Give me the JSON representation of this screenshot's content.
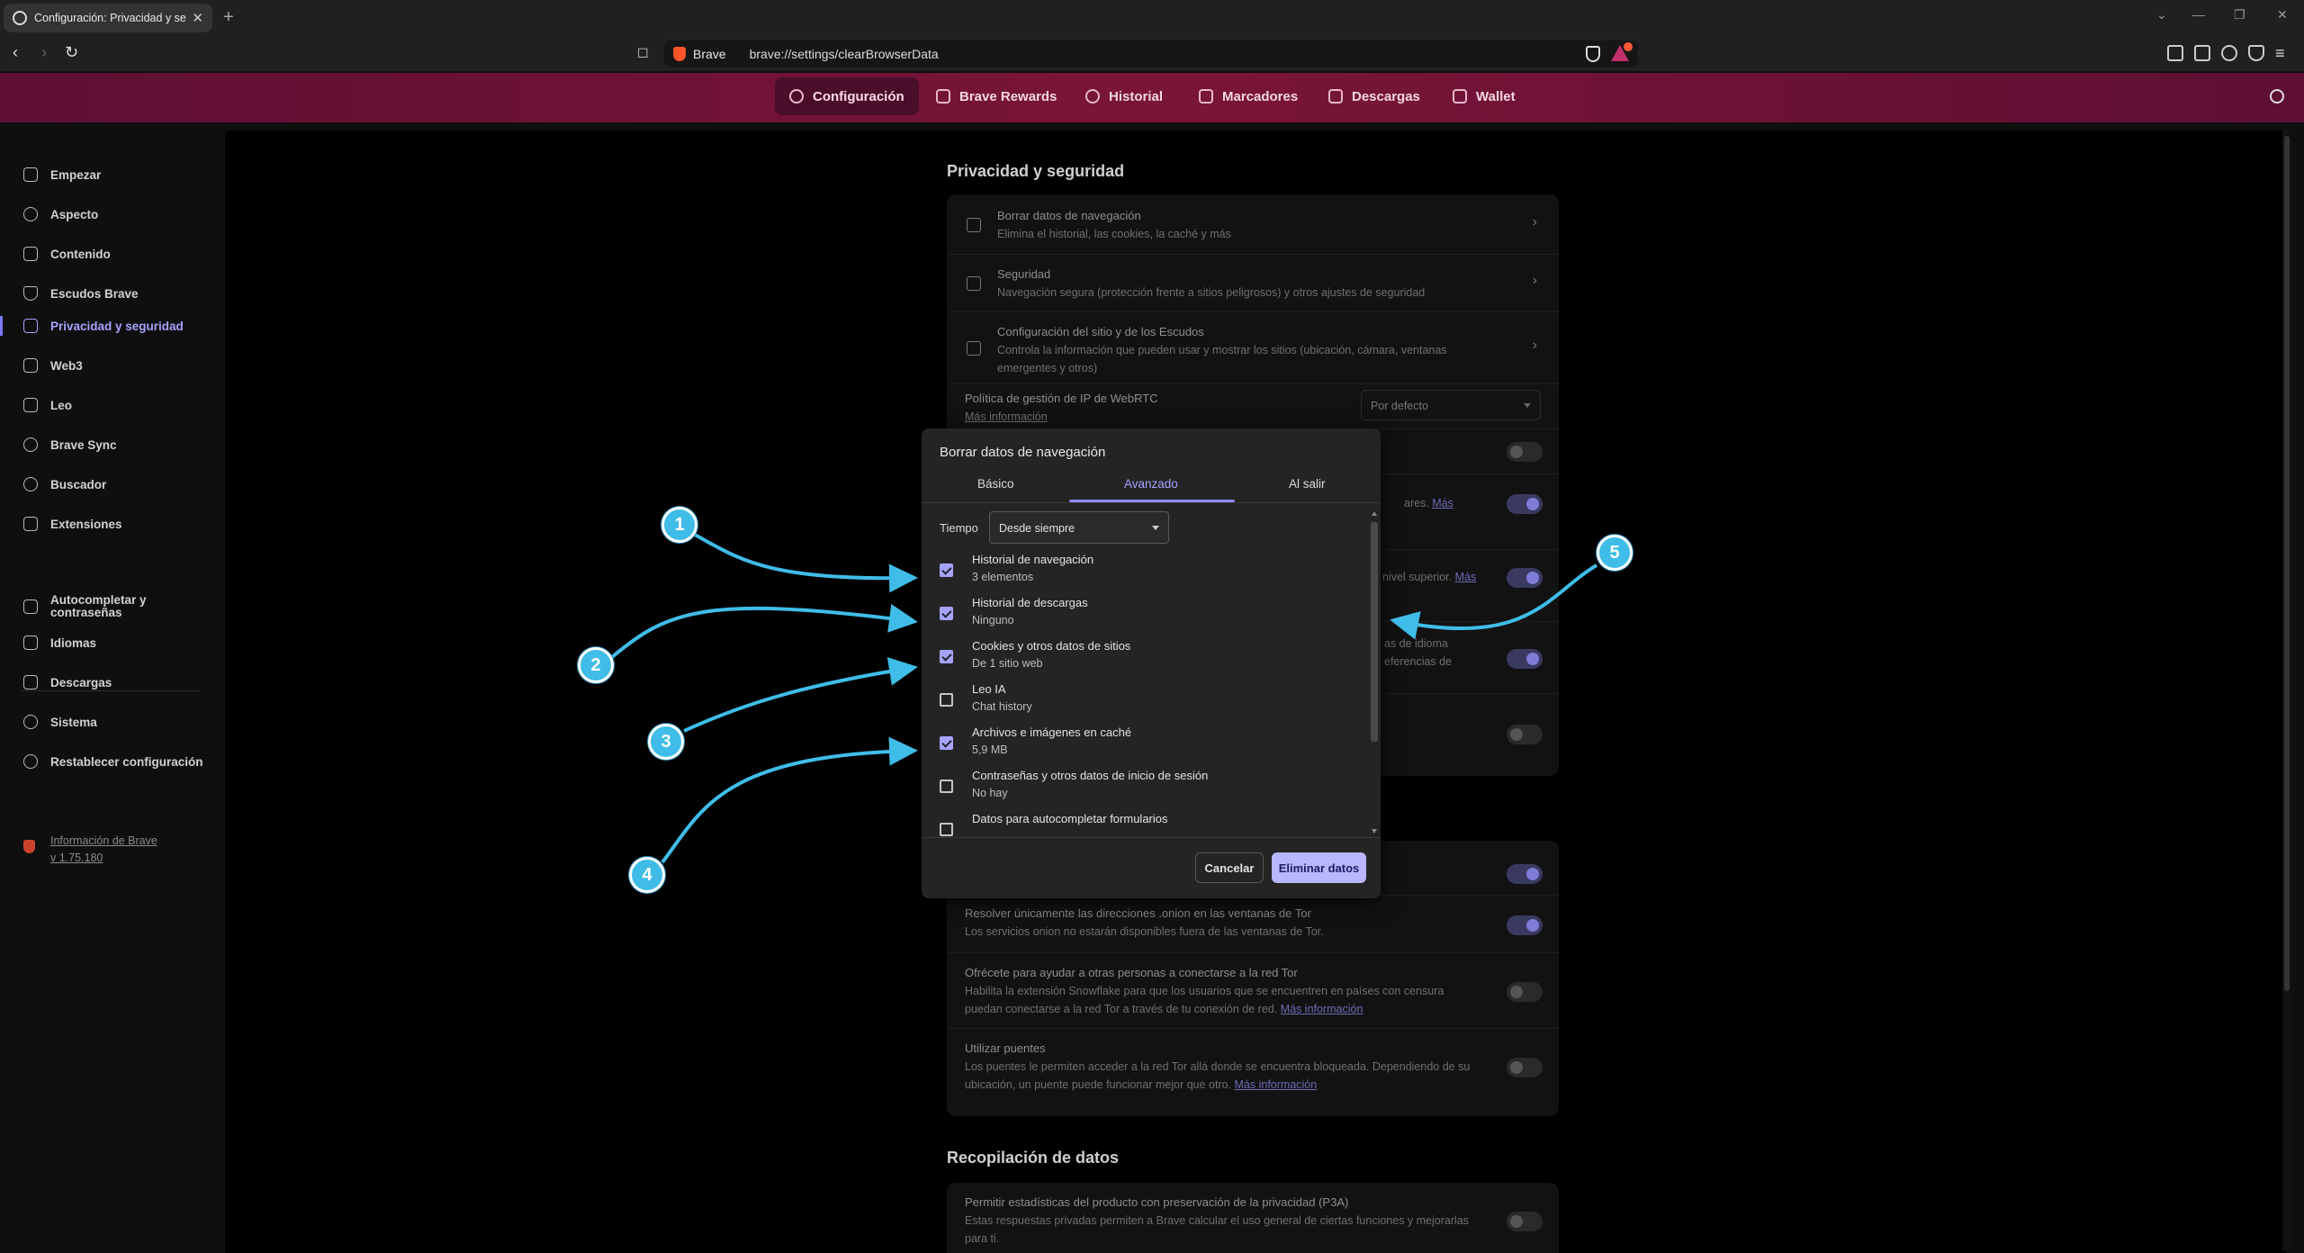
{
  "tab": {
    "title": "Configuración: Privacidad y seg",
    "close": "✕"
  },
  "newtab": "+",
  "window_controls": {
    "dropdown": "⌄",
    "minimize": "—",
    "restore": "❐",
    "close": "✕"
  },
  "toolbar": {
    "back": "‹",
    "forward": "›",
    "reload": "↻",
    "bookmark": "☐",
    "site_name": "Brave",
    "url": "brave://settings/clearBrowserData",
    "menu": "≡"
  },
  "nav": {
    "items": [
      "Configuración",
      "Brave Rewards",
      "Historial",
      "Marcadores",
      "Descargas",
      "Wallet"
    ],
    "active": 0
  },
  "sidebar": {
    "items": [
      "Empezar",
      "Aspecto",
      "Contenido",
      "Escudos Brave",
      "Privacidad y seguridad",
      "Web3",
      "Leo",
      "Brave Sync",
      "Buscador",
      "Extensiones",
      "Autocompletar y contraseñas",
      "Idiomas",
      "Descargas",
      "Sistema",
      "Restablecer configuración"
    ],
    "active": 4,
    "about_line1": "Información de Brave",
    "about_line2": "v 1.75.180"
  },
  "privacy": {
    "title": "Privacidad y seguridad",
    "rows": [
      {
        "title": "Borrar datos de navegación",
        "desc": "Elimina el historial, las cookies, la caché y más"
      },
      {
        "title": "Seguridad",
        "desc": "Navegación segura (protección frente a sitios peligrosos) y otros ajustes de seguridad"
      },
      {
        "title": "Configuración del sitio y de los Escudos",
        "desc1": "Controla la información que pueden usar y mostrar los sitios (ubicación, cámara, ventanas",
        "desc2": "emergentes y otros)"
      }
    ],
    "webrtc": {
      "title": "Política de gestión de IP de WebRTC",
      "link": "Más información",
      "value": "Por defecto"
    },
    "partial": {
      "a": "ares. ",
      "a_link": "Más",
      "b": "nivel superior. ",
      "b_link": "Más",
      "c1": "as de idioma",
      "c2": "eferencias de"
    }
  },
  "tor": {
    "row1": {
      "title": "Resolver únicamente las direcciones .onion en las ventanas de Tor",
      "desc": "Los servicios onion no estarán disponibles fuera de las ventanas de Tor."
    },
    "row2": {
      "title": "Ofrécete para ayudar a otras personas a conectarse a la red Tor",
      "desc1": "Habilita la extensión Snowflake para que los usuarios que se encuentren en países con censura",
      "desc2": "puedan conectarse a la red Tor a través de tu conexión de red. ",
      "link": "Más información"
    },
    "row3": {
      "title": "Utilizar puentes",
      "desc1": "Los puentes le permiten acceder a la red Tor allá donde se encuentra bloqueada. Dependiendo de su",
      "desc2": "ubicación, un puente puede funcionar mejor que otro. ",
      "link": "Más información"
    }
  },
  "data_collection": {
    "title": "Recopilación de datos",
    "row": {
      "title": "Permitir estadísticas del producto con preservación de la privacidad (P3A)",
      "desc1": "Estas respuestas privadas permiten a Brave calcular el uso general de ciertas funciones y mejorarlas",
      "desc2": "para ti."
    }
  },
  "dialog": {
    "title": "Borrar datos de navegación",
    "tabs": [
      "Básico",
      "Avanzado",
      "Al salir"
    ],
    "active_tab": 1,
    "time_label": "Tiempo",
    "time_value": "Desde siempre",
    "items": [
      {
        "label": "Historial de navegación",
        "detail": "3 elementos",
        "checked": true
      },
      {
        "label": "Historial de descargas",
        "detail": "Ninguno",
        "checked": true
      },
      {
        "label": "Cookies y otros datos de sitios",
        "detail": "De 1 sitio web",
        "checked": true
      },
      {
        "label": "Leo IA",
        "detail": "Chat history",
        "checked": false
      },
      {
        "label": "Archivos e imágenes en caché",
        "detail": "5,9 MB",
        "checked": true
      },
      {
        "label": "Contraseñas y otros datos de inicio de sesión",
        "detail": "No hay",
        "checked": false
      },
      {
        "label": "Datos para autocompletar formularios",
        "detail": "",
        "checked": false
      }
    ],
    "cancel": "Cancelar",
    "confirm": "Eliminar datos"
  },
  "annotations": [
    "1",
    "2",
    "3",
    "4",
    "5"
  ],
  "colors": {
    "accent": "#a6a3ff",
    "nav_bg": "#7a1538",
    "annotation": "#3fbde8"
  }
}
